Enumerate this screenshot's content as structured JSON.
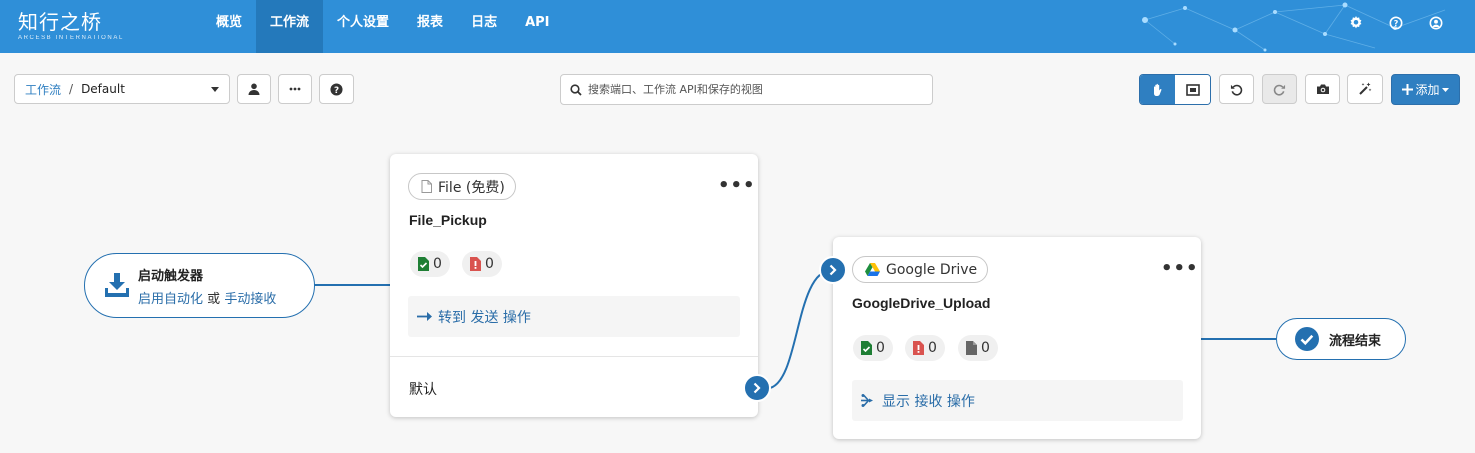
{
  "app": {
    "logo": "知行之桥",
    "logo_sub": "ARCESB INTERNATIONAL"
  },
  "nav": {
    "items": [
      {
        "label": "概览",
        "active": false
      },
      {
        "label": "工作流",
        "active": true
      },
      {
        "label": "个人设置",
        "active": false
      },
      {
        "label": "报表",
        "active": false
      },
      {
        "label": "日志",
        "active": false
      },
      {
        "label": "API",
        "active": false
      }
    ],
    "right_icons": [
      "gear-icon",
      "help-icon",
      "user-icon"
    ]
  },
  "toolbar": {
    "breadcrumb_root": "工作流",
    "breadcrumb_sep": "/",
    "workspace": "Default",
    "search_placeholder": "搜索端口、工作流 API和保存的视图",
    "add_label": "添加"
  },
  "trigger": {
    "title": "启动触发器",
    "link1": "启用自动化",
    "or": "或",
    "link2": "手动接收"
  },
  "cards": [
    {
      "connector_type": "File (免费)",
      "name": "File_Pickup",
      "stats": [
        {
          "kind": "success",
          "count": "0"
        },
        {
          "kind": "error",
          "count": "0"
        }
      ],
      "action": "转到 发送 操作",
      "output_label": "默认"
    },
    {
      "connector_type": "Google Drive",
      "name": "GoogleDrive_Upload",
      "stats": [
        {
          "kind": "success",
          "count": "0"
        },
        {
          "kind": "error",
          "count": "0"
        },
        {
          "kind": "pending",
          "count": "0"
        }
      ],
      "action": "显示 接收 操作"
    }
  ],
  "end_node": {
    "label": "流程结束"
  },
  "colors": {
    "header": "#2f8fd8",
    "primary": "#2f7fc1",
    "link": "#2a6da8",
    "success": "#1e7e34",
    "error": "#d9534f"
  }
}
